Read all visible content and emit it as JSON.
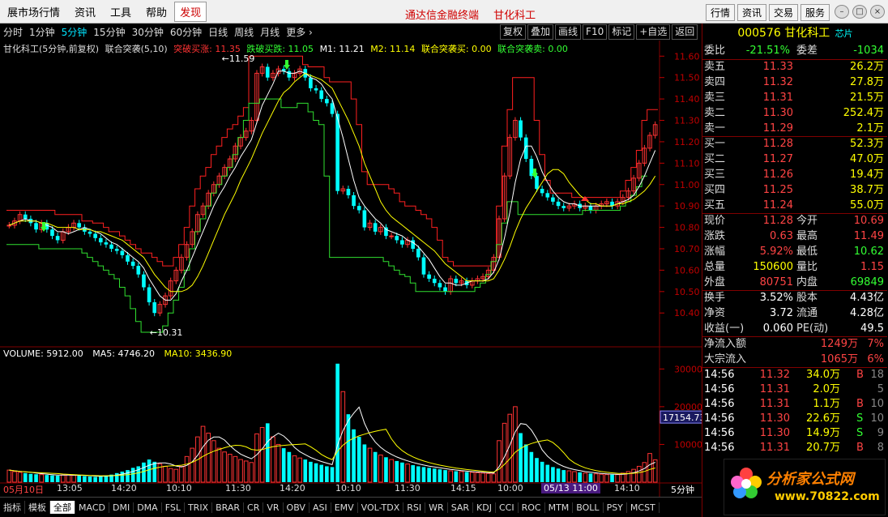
{
  "menu": {
    "items": [
      "展市场行情",
      "资讯",
      "工具",
      "帮助"
    ],
    "highlight": "发现",
    "center": [
      "通达信金融终端",
      "甘化科工"
    ],
    "right_buttons": [
      "行情",
      "资讯",
      "交易",
      "服务"
    ]
  },
  "timeframes": [
    "分时",
    "1分钟",
    "5分钟",
    "15分钟",
    "30分钟",
    "60分钟",
    "日线",
    "周线",
    "月线",
    "更多 ›"
  ],
  "active_timeframe": "5分钟",
  "tools": [
    "复权",
    "叠加",
    "画线",
    "F10",
    "标记",
    "+自选",
    "返回"
  ],
  "legend": {
    "name": "甘化科工(5分钟,前复权)",
    "indicator": "联合突袭(5,10)",
    "items": [
      {
        "label": "突破买涨: 11.35",
        "color": "#ff3333"
      },
      {
        "label": "跌破买跌: 11.05",
        "color": "#33ff33"
      },
      {
        "label": "M1: 11.21",
        "color": "#ffffff"
      },
      {
        "label": "M2: 11.14",
        "color": "#ffff00"
      },
      {
        "label": "联合突袭买: 0.00",
        "color": "#ffff00"
      },
      {
        "label": "联合突袭卖: 0.00",
        "color": "#33ff33"
      }
    ]
  },
  "volume_legend": {
    "vol": "VOLUME: 5912.00",
    "ma5": "MA5: 4746.20",
    "ma10": "MA10: 3436.90"
  },
  "high_label": "11.59",
  "low_label": "10.31",
  "cursor_price": "17154.73",
  "cursor_time": "05/13 11:00",
  "period_label": "5分钟",
  "bottom_tabs": [
    "指标",
    "模板",
    "全部",
    "MACD",
    "DMI",
    "DMA",
    "FSL",
    "TRIX",
    "BRAR",
    "CR",
    "VR",
    "OBV",
    "ASI",
    "EMV",
    "VOL-TDX",
    "RSI",
    "WR",
    "SAR",
    "KDJ",
    "CCI",
    "ROC",
    "MTM",
    "BOLL",
    "PSY",
    "MCST"
  ],
  "active_bottom_tab": "全部",
  "time_axis": [
    "05月10日",
    "13:05",
    "14:20",
    "10:10",
    "11:30",
    "14:20",
    "10:10",
    "11:30",
    "14:15",
    "10:00",
    "14:10"
  ],
  "stock": {
    "code": "000576",
    "name": "甘化科工",
    "chip": "芯片",
    "wei_bi_label": "委比",
    "wei_bi": "-21.51%",
    "wei_cha_label": "委差",
    "wei_cha": "-1034"
  },
  "sell_orders": [
    {
      "label": "卖五",
      "price": "11.33",
      "vol": "26.2万"
    },
    {
      "label": "卖四",
      "price": "11.32",
      "vol": "27.8万"
    },
    {
      "label": "卖三",
      "price": "11.31",
      "vol": "21.5万"
    },
    {
      "label": "卖二",
      "price": "11.30",
      "vol": "252.4万"
    },
    {
      "label": "卖一",
      "price": "11.29",
      "vol": "2.1万"
    }
  ],
  "buy_orders": [
    {
      "label": "买一",
      "price": "11.28",
      "vol": "52.3万"
    },
    {
      "label": "买二",
      "price": "11.27",
      "vol": "47.0万"
    },
    {
      "label": "买三",
      "price": "11.26",
      "vol": "19.4万"
    },
    {
      "label": "买四",
      "price": "11.25",
      "vol": "38.7万"
    },
    {
      "label": "买五",
      "price": "11.24",
      "vol": "55.0万"
    }
  ],
  "quote": [
    {
      "l1": "现价",
      "v1": "11.28",
      "c1": "#ff4444",
      "l2": "今开",
      "v2": "10.69",
      "c2": "#ff4444"
    },
    {
      "l1": "涨跌",
      "v1": "0.63",
      "c1": "#ff4444",
      "l2": "最高",
      "v2": "11.49",
      "c2": "#ff4444"
    },
    {
      "l1": "涨幅",
      "v1": "5.92%",
      "c1": "#ff4444",
      "l2": "最低",
      "v2": "10.62",
      "c2": "#33ff33"
    },
    {
      "l1": "总量",
      "v1": "150600",
      "c1": "#ffff00",
      "l2": "量比",
      "v2": "1.15",
      "c2": "#ff4444"
    },
    {
      "l1": "外盘",
      "v1": "80751",
      "c1": "#ff4444",
      "l2": "内盘",
      "v2": "69849",
      "c2": "#33ff33"
    }
  ],
  "fundamentals": [
    {
      "l1": "换手",
      "v1": "3.52%",
      "l2": "股本",
      "v2": "4.43亿"
    },
    {
      "l1": "净资",
      "v1": "3.72",
      "l2": "流通",
      "v2": "4.28亿"
    },
    {
      "l1": "收益(一)",
      "v1": "0.060",
      "l2": "PE(动)",
      "v2": "49.5"
    }
  ],
  "flows": [
    {
      "label": "净流入额",
      "value": "1249万",
      "pct": "7%"
    },
    {
      "label": "大宗流入",
      "value": "1065万",
      "pct": "6%"
    }
  ],
  "ticks": [
    {
      "time": "14:56",
      "price": "11.32",
      "vol": "34.0万",
      "side": "B",
      "n": "18"
    },
    {
      "time": "14:56",
      "price": "11.31",
      "vol": "2.0万",
      "side": "",
      "n": "5"
    },
    {
      "time": "14:56",
      "price": "11.31",
      "vol": "1.1万",
      "side": "B",
      "n": "10"
    },
    {
      "time": "14:56",
      "price": "11.30",
      "vol": "22.6万",
      "side": "S",
      "n": "10"
    },
    {
      "time": "14:56",
      "price": "11.30",
      "vol": "14.9万",
      "side": "S",
      "n": "9"
    },
    {
      "time": "14:56",
      "price": "11.31",
      "vol": "20.7万",
      "side": "B",
      "n": "8"
    }
  ],
  "logo": {
    "name": "分析家公式网",
    "url": "www.70822.com"
  },
  "colors": {
    "up": "#ff3333",
    "down": "#00ffff",
    "ma1": "#ffffff",
    "ma2": "#ffff00",
    "upper": "#ff2020",
    "lower": "#30e030"
  },
  "chart_data": {
    "type": "candlestick",
    "y_range": [
      10.31,
      11.62
    ],
    "y_ticks": [
      11.6,
      11.5,
      11.4,
      11.3,
      11.2,
      11.1,
      11.0,
      10.9,
      10.8,
      10.7,
      10.6,
      10.5,
      10.4
    ],
    "vol_ticks": [
      30000,
      20000,
      10000
    ],
    "vol_range": [
      0,
      32000
    ],
    "close": [
      10.81,
      10.83,
      10.86,
      10.84,
      10.82,
      10.79,
      10.82,
      10.79,
      10.76,
      10.74,
      10.78,
      10.8,
      10.82,
      10.8,
      10.78,
      10.77,
      10.75,
      10.73,
      10.72,
      10.7,
      10.69,
      10.67,
      10.64,
      10.62,
      10.58,
      10.52,
      10.45,
      10.4,
      10.44,
      10.48,
      10.55,
      10.6,
      10.66,
      10.72,
      10.78,
      10.86,
      10.9,
      10.96,
      11.0,
      11.04,
      11.08,
      11.12,
      11.18,
      11.22,
      11.25,
      11.3,
      11.52,
      11.55,
      11.5,
      11.52,
      11.54,
      11.53,
      11.5,
      11.52,
      11.54,
      11.5,
      11.45,
      11.44,
      11.4,
      11.38,
      11.33,
      10.97,
      10.98,
      10.95,
      10.9,
      10.88,
      10.8,
      10.82,
      10.78,
      10.8,
      10.76,
      10.76,
      10.74,
      10.72,
      10.74,
      10.7,
      10.66,
      10.58,
      10.56,
      10.54,
      10.52,
      10.5,
      10.56,
      10.54,
      10.55,
      10.53,
      10.55,
      10.56,
      10.57,
      10.6,
      10.66,
      10.84,
      11.04,
      11.22,
      11.3,
      11.22,
      11.12,
      11.04,
      10.98,
      10.96,
      10.94,
      10.92,
      10.9,
      10.89,
      10.9,
      10.91,
      10.89,
      10.9,
      10.88,
      10.9,
      10.91,
      10.92,
      10.9,
      10.92,
      10.94,
      10.97,
      11.03,
      11.1,
      11.17,
      11.23,
      11.28
    ],
    "volume": [
      3200,
      2800,
      2600,
      2400,
      2200,
      2100,
      2000,
      1900,
      1800,
      1700,
      1900,
      2000,
      1800,
      1700,
      1600,
      1500,
      1400,
      1600,
      1800,
      2000,
      2400,
      2800,
      3200,
      3800,
      4200,
      5200,
      6000,
      5400,
      4800,
      4200,
      3600,
      3400,
      4200,
      6800,
      9000,
      12000,
      14800,
      13000,
      11000,
      9000,
      8000,
      7400,
      6800,
      6000,
      5600,
      5200,
      12800,
      14500,
      15600,
      12000,
      10000,
      9000,
      8000,
      7000,
      6400,
      6000,
      5400,
      5000,
      4600,
      4200,
      4000,
      31400,
      24000,
      18000,
      14000,
      12000,
      10000,
      9000,
      8000,
      7200,
      6600,
      6000,
      5600,
      5200,
      4800,
      4500,
      4200,
      4000,
      3800,
      3600,
      3400,
      3200,
      3000,
      2900,
      2800,
      2700,
      2600,
      2500,
      2400,
      2300,
      2200,
      11000,
      15600,
      18000,
      20000,
      13000,
      10000,
      8000,
      6400,
      5400,
      4600,
      4000,
      3600,
      3200,
      3000,
      2800,
      2600,
      2400,
      2300,
      2200,
      2100,
      2000,
      2000,
      2000,
      2400,
      2800,
      3400,
      4200,
      5200,
      7600,
      5912
    ],
    "ma5": [
      10.81,
      10.82,
      10.83,
      10.84,
      10.83,
      10.83,
      10.82,
      10.81,
      10.8,
      10.78,
      10.78,
      10.77,
      10.78,
      10.79,
      10.8,
      10.79,
      10.78,
      10.77,
      10.75,
      10.73,
      10.72,
      10.7,
      10.68,
      10.66,
      10.64,
      10.61,
      10.56,
      10.52,
      10.48,
      10.46,
      10.46,
      10.49,
      10.55,
      10.6,
      10.66,
      10.72,
      10.78,
      10.84,
      10.9,
      10.95,
      10.99,
      11.04,
      11.08,
      11.13,
      11.17,
      11.21,
      11.29,
      11.37,
      11.42,
      11.47,
      11.53,
      11.53,
      11.52,
      11.52,
      11.53,
      11.52,
      11.5,
      11.49,
      11.47,
      11.43,
      11.4,
      11.31,
      11.22,
      11.12,
      11.02,
      10.94,
      10.9,
      10.87,
      10.84,
      10.82,
      10.79,
      10.78,
      10.77,
      10.76,
      10.74,
      10.73,
      10.71,
      10.68,
      10.65,
      10.61,
      10.57,
      10.54,
      10.54,
      10.53,
      10.53,
      10.54,
      10.55,
      10.55,
      10.55,
      10.56,
      10.59,
      10.65,
      10.75,
      10.87,
      11.01,
      11.12,
      11.18,
      11.18,
      11.13,
      11.06,
      11.01,
      10.97,
      10.94,
      10.92,
      10.91,
      10.91,
      10.9,
      10.9,
      10.9,
      10.9,
      10.9,
      10.9,
      10.9,
      10.91,
      10.92,
      10.93,
      10.95,
      10.99,
      11.04,
      11.1,
      11.16
    ],
    "ma10": [
      10.81,
      10.82,
      10.83,
      10.83,
      10.83,
      10.83,
      10.82,
      10.82,
      10.81,
      10.8,
      10.8,
      10.8,
      10.8,
      10.79,
      10.79,
      10.79,
      10.78,
      10.78,
      10.77,
      10.76,
      10.75,
      10.74,
      10.72,
      10.7,
      10.68,
      10.66,
      10.62,
      10.58,
      10.55,
      10.52,
      10.5,
      10.5,
      10.5,
      10.51,
      10.53,
      10.57,
      10.62,
      10.68,
      10.74,
      10.8,
      10.86,
      10.91,
      10.96,
      11.02,
      11.07,
      11.12,
      11.18,
      11.24,
      11.29,
      11.34,
      11.39,
      11.43,
      11.45,
      11.48,
      11.5,
      11.52,
      11.51,
      11.5,
      11.49,
      11.47,
      11.45,
      11.4,
      11.35,
      11.3,
      11.24,
      11.18,
      11.1,
      11.04,
      10.98,
      10.92,
      10.88,
      10.85,
      10.83,
      10.81,
      10.79,
      10.77,
      10.75,
      10.73,
      10.71,
      10.69,
      10.66,
      10.63,
      10.61,
      10.59,
      10.57,
      10.55,
      10.55,
      10.55,
      10.55,
      10.55,
      10.56,
      10.6,
      10.65,
      10.71,
      10.78,
      10.84,
      10.89,
      10.93,
      10.97,
      11.01,
      11.05,
      11.07,
      11.07,
      11.05,
      11.01,
      10.98,
      10.95,
      10.93,
      10.91,
      10.91,
      10.9,
      10.9,
      10.9,
      10.91,
      10.91,
      10.92,
      10.93,
      10.95,
      10.97,
      11.0,
      11.04
    ],
    "upper": [
      10.88,
      10.88,
      10.88,
      10.88,
      10.88,
      10.88,
      10.88,
      10.88,
      10.88,
      10.86,
      10.86,
      10.86,
      10.86,
      10.86,
      10.83,
      10.83,
      10.82,
      10.82,
      10.8,
      10.78,
      10.78,
      10.76,
      10.74,
      10.72,
      10.7,
      10.68,
      10.68,
      10.66,
      10.64,
      10.62,
      10.62,
      10.66,
      10.72,
      10.8,
      10.9,
      10.98,
      11.04,
      11.08,
      11.14,
      11.18,
      11.22,
      11.26,
      11.28,
      11.32,
      11.36,
      11.6,
      11.6,
      11.6,
      11.6,
      11.6,
      11.6,
      11.6,
      11.6,
      11.6,
      11.6,
      11.56,
      11.55,
      11.55,
      11.55,
      11.5,
      11.48,
      11.48,
      11.48,
      11.48,
      11.4,
      11.28,
      11.06,
      11.0,
      11.0,
      11.0,
      11.0,
      10.98,
      10.96,
      10.92,
      10.9,
      10.9,
      10.88,
      10.86,
      10.84,
      10.8,
      10.74,
      10.66,
      10.64,
      10.62,
      10.62,
      10.62,
      10.62,
      10.62,
      10.62,
      10.62,
      10.64,
      10.9,
      11.18,
      11.35,
      11.5,
      11.5,
      11.5,
      11.5,
      11.3,
      11.14,
      11.02,
      10.96,
      10.96,
      10.96,
      10.96,
      10.94,
      10.94,
      10.94,
      10.94,
      10.94,
      10.94,
      10.94,
      10.94,
      10.94,
      10.97,
      11.02,
      11.08,
      11.16,
      11.3,
      11.35,
      11.35
    ],
    "lower": [
      10.72,
      10.72,
      10.72,
      10.72,
      10.72,
      10.72,
      10.7,
      10.7,
      10.7,
      10.7,
      10.7,
      10.7,
      10.7,
      10.7,
      10.68,
      10.66,
      10.64,
      10.62,
      10.6,
      10.58,
      10.56,
      10.52,
      10.48,
      10.42,
      10.36,
      10.31,
      10.31,
      10.31,
      10.31,
      10.34,
      10.4,
      10.46,
      10.52,
      10.6,
      10.7,
      10.78,
      10.84,
      10.9,
      10.96,
      11.0,
      11.04,
      11.08,
      11.14,
      11.22,
      11.3,
      11.38,
      11.38,
      11.4,
      11.4,
      11.4,
      11.4,
      11.36,
      11.36,
      11.36,
      11.38,
      11.38,
      11.34,
      11.3,
      11.28,
      11.04,
      10.66,
      10.66,
      10.66,
      10.66,
      10.66,
      10.66,
      10.66,
      10.66,
      10.66,
      10.66,
      10.64,
      10.62,
      10.6,
      10.58,
      10.57,
      10.54,
      10.5,
      10.5,
      10.5,
      10.5,
      10.5,
      10.5,
      10.5,
      10.5,
      10.5,
      10.5,
      10.5,
      10.52,
      10.54,
      10.58,
      10.64,
      10.72,
      10.82,
      10.92,
      10.92,
      10.86,
      10.86,
      10.86,
      10.86,
      10.86,
      10.86,
      10.86,
      10.86,
      10.86,
      10.86,
      10.86,
      10.86,
      10.88,
      10.88,
      10.88,
      10.88,
      10.88,
      10.88,
      10.88,
      10.9,
      10.92,
      10.95,
      10.99,
      11.04
    ]
  }
}
